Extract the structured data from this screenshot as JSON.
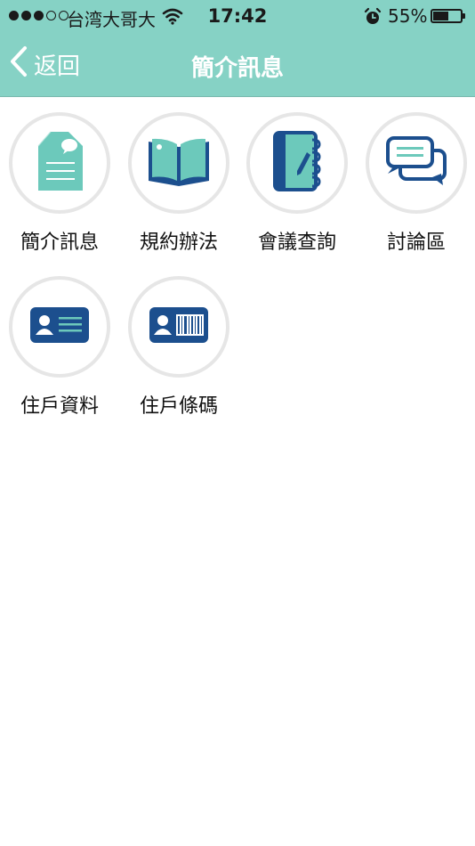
{
  "status_bar": {
    "carrier": "台湾大哥大",
    "time": "17:42",
    "battery_percent_text": "55%",
    "battery_level": 0.55,
    "signal_bars_filled": 3,
    "signal_bars_total": 5
  },
  "nav": {
    "back_label": "返回",
    "title": "簡介訊息"
  },
  "colors": {
    "header_bg": "#86d2c5",
    "icon_teal": "#6cc9bb",
    "icon_navy": "#1c4f8e",
    "circle_border": "#e6e6e6"
  },
  "tiles": [
    {
      "label": "簡介訊息",
      "icon": "document-icon"
    },
    {
      "label": "規約辦法",
      "icon": "open-book-icon"
    },
    {
      "label": "會議查詢",
      "icon": "notebook-icon"
    },
    {
      "label": "討論區",
      "icon": "chat-bubbles-icon"
    },
    {
      "label": "住戶資料",
      "icon": "id-card-icon"
    },
    {
      "label": "住戶條碼",
      "icon": "barcode-card-icon"
    }
  ]
}
